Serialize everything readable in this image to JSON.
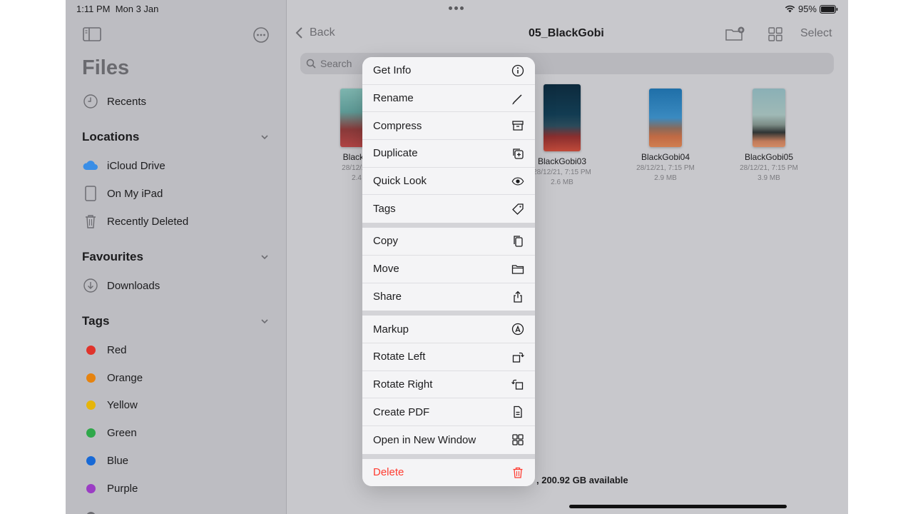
{
  "status": {
    "time": "1:11 PM",
    "date": "Mon 3 Jan",
    "battery": "95%"
  },
  "sidebar": {
    "title": "Files",
    "recents": "Recents",
    "locations": {
      "heading": "Locations",
      "items": [
        "iCloud Drive",
        "On My iPad",
        "Recently Deleted"
      ]
    },
    "favourites": {
      "heading": "Favourites",
      "items": [
        "Downloads"
      ]
    },
    "tags": {
      "heading": "Tags",
      "items": [
        {
          "label": "Red",
          "color": "#e0332b"
        },
        {
          "label": "Orange",
          "color": "#e6830f"
        },
        {
          "label": "Yellow",
          "color": "#e6b50a"
        },
        {
          "label": "Green",
          "color": "#2fa84a"
        },
        {
          "label": "Blue",
          "color": "#1769d6"
        },
        {
          "label": "Purple",
          "color": "#9b3dc4"
        }
      ]
    }
  },
  "nav": {
    "back": "Back",
    "title": "05_BlackGobi",
    "select": "Select"
  },
  "search": {
    "placeholder": "Search"
  },
  "files": [
    {
      "name": "BlackG",
      "date": "28/12/21,",
      "size": "2.4"
    },
    {
      "name": "BlackGobi03",
      "date": "28/12/21, 7:15 PM",
      "size": "2.6 MB"
    },
    {
      "name": "BlackGobi04",
      "date": "28/12/21, 7:15 PM",
      "size": "2.9 MB"
    },
    {
      "name": "BlackGobi05",
      "date": "28/12/21, 7:15 PM",
      "size": "3.9 MB"
    }
  ],
  "storage": ", 200.92 GB available",
  "menu": {
    "group1": [
      "Get Info",
      "Rename",
      "Compress",
      "Duplicate",
      "Quick Look",
      "Tags"
    ],
    "group2": [
      "Copy",
      "Move",
      "Share"
    ],
    "group3": [
      "Markup",
      "Rotate Left",
      "Rotate Right",
      "Create PDF",
      "Open in New Window"
    ],
    "delete": "Delete"
  },
  "colors": {
    "accent_gray": "#6d6d72",
    "danger": "#ff3b30"
  }
}
